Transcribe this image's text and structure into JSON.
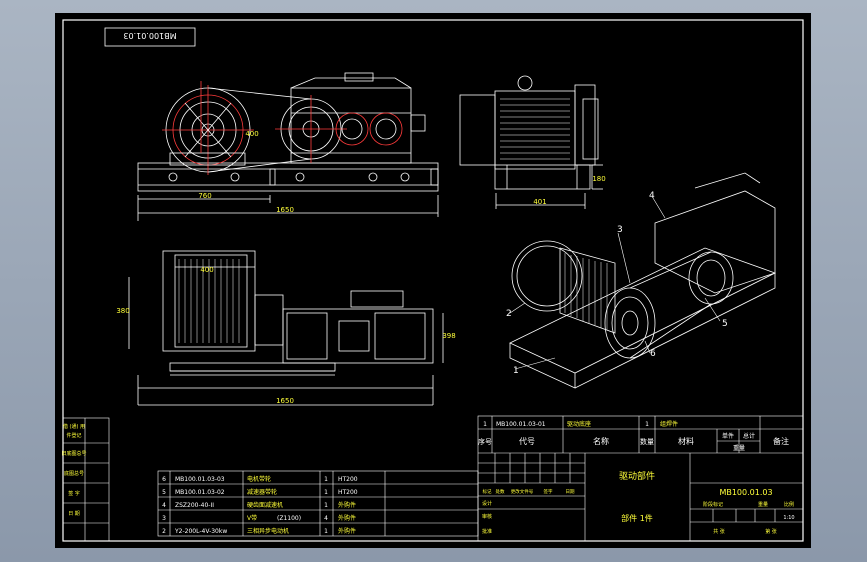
{
  "drawing_number_rotated": "MB100.01.03",
  "dims": {
    "front_length_a": "760",
    "front_length_b": "1650",
    "front_height": "400",
    "side_width": "401",
    "side_height": "180",
    "top_length": "1650",
    "top_width": "380",
    "top_motor": "400",
    "top_left": "380",
    "top_right": "398"
  },
  "balloons": [
    "1",
    "2",
    "3",
    "4",
    "5",
    "6"
  ],
  "parts_list": [
    {
      "no": "6",
      "code": "MB100.01.03-03",
      "name": "电机带轮",
      "qty": "1",
      "material": "HT200"
    },
    {
      "no": "5",
      "code": "MB100.01.03-02",
      "name": "减速器带轮",
      "qty": "1",
      "material": "HT200"
    },
    {
      "no": "4",
      "code": "ZSZ200-40-II",
      "name": "硬齿面减速机",
      "qty": "1",
      "material": "外购件"
    },
    {
      "no": "3",
      "code": "V带",
      "code2": "(Z1100)",
      "name": "",
      "qty": "4",
      "material": "外购件"
    },
    {
      "no": "2",
      "code": "Y2-200L-4V-30kw",
      "name": "三相异步电动机",
      "qty": "1",
      "material": "外购件"
    }
  ],
  "parts_list_top": {
    "no": "1",
    "code": "MB100.01.03-01",
    "name": "驱动底座",
    "qty": "1",
    "material": "组焊件"
  },
  "parts_header": {
    "no": "序号",
    "code": "代号",
    "name": "名称",
    "qty": "数量",
    "material": "材料",
    "unit": "单件",
    "total": "总计",
    "weight": "重量",
    "remark": "备注"
  },
  "title_block": {
    "name": "驱动部件",
    "drawing_no": "MB100.01.03",
    "count": "部件  1件",
    "rev_labels": [
      "标记",
      "处数",
      "更改文件号",
      "签字",
      "日期"
    ],
    "design": "设计",
    "check": "审核",
    "approve": "批准",
    "stage": "阶段标记",
    "weight": "重量",
    "scale": "比例",
    "scale_value": "1:10",
    "sheets": "共 张",
    "sheet_of": "第 张"
  },
  "left_strip": [
    "借 (通) 用",
    "件登记",
    "旧底图总号",
    "底图总号",
    "签 字",
    "日 期"
  ],
  "colors": {
    "background": "#000000",
    "line": "#ffffff",
    "highlight": "#ff3b3b",
    "text_yellow": "#ffff3a",
    "frame": "#8d9aab"
  }
}
